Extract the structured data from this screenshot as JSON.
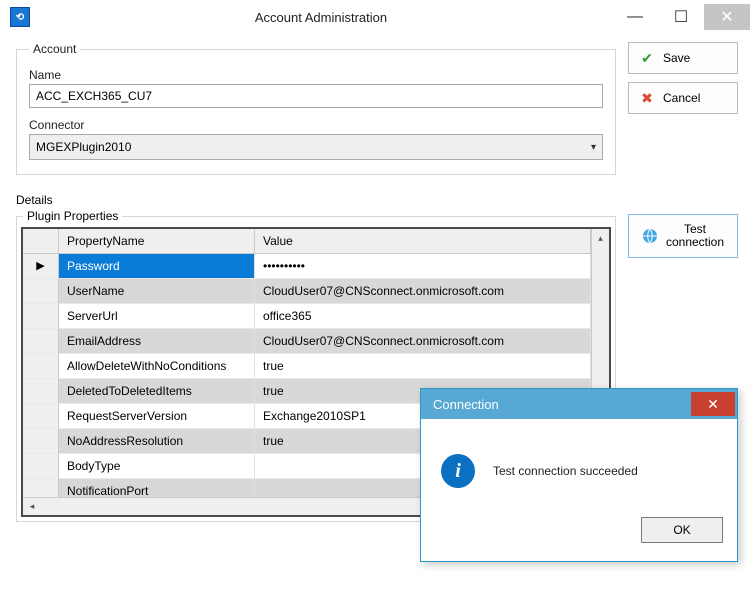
{
  "window": {
    "title": "Account Administration"
  },
  "account": {
    "legend": "Account",
    "name_label": "Name",
    "name_value": "ACC_EXCH365_CU7",
    "connector_label": "Connector",
    "connector_value": "MGEXPlugin2010"
  },
  "details": {
    "label": "Details",
    "plugin_legend": "Plugin Properties",
    "columns": {
      "col1": "PropertyName",
      "col2": "Value"
    },
    "rows": [
      {
        "name": "Password",
        "value": "••••••••••",
        "selected": true
      },
      {
        "name": "UserName",
        "value": "CloudUser07@CNSconnect.onmicrosoft.com"
      },
      {
        "name": "ServerUrl",
        "value": "office365"
      },
      {
        "name": "EmailAddress",
        "value": "CloudUser07@CNSconnect.onmicrosoft.com"
      },
      {
        "name": "AllowDeleteWithNoConditions",
        "value": "true"
      },
      {
        "name": "DeletedToDeletedItems",
        "value": "true"
      },
      {
        "name": "RequestServerVersion",
        "value": "Exchange2010SP1"
      },
      {
        "name": "NoAddressResolution",
        "value": "true"
      },
      {
        "name": "BodyType",
        "value": ""
      },
      {
        "name": "NotificationPort",
        "value": ""
      }
    ]
  },
  "buttons": {
    "save": "Save",
    "cancel": "Cancel",
    "test_line1": "Test",
    "test_line2": "connection"
  },
  "dialog": {
    "title": "Connection",
    "message": "Test connection succeeded",
    "ok": "OK"
  }
}
